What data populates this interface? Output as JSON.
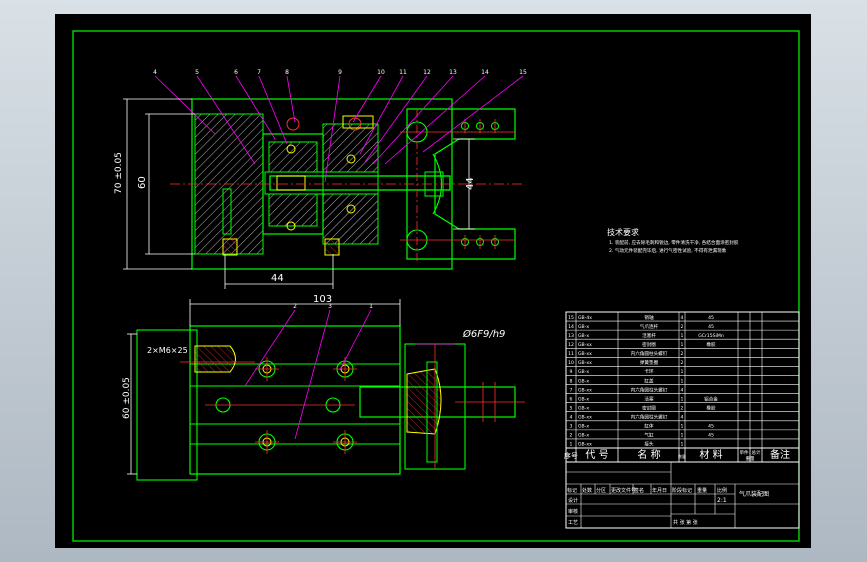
{
  "drawing": {
    "tech_req_title": "技术要求",
    "tech_req_lines": [
      "1. 装配前, 应去除毛刺和锐边, 零件清洗干净, 各结合面涂密封胶",
      "2. 气动元件装配完毕后, 进行气密性试验, 不得有泄漏现象"
    ],
    "top_view": {
      "balloons": [
        "4",
        "5",
        "6",
        "7",
        "8",
        "9",
        "10",
        "11",
        "12",
        "13",
        "14",
        "15"
      ],
      "dim_height_outer": "70 ±0.05",
      "dim_height_inner": "60",
      "dim_bottom": "44",
      "dim_right": "44"
    },
    "front_view": {
      "balloons": [
        "2",
        "3",
        "1"
      ],
      "dim_width": "103",
      "fit_note": "Ø6F9/h9",
      "thread_note": "2×M6×25",
      "dim_height": "60 ±0.05"
    },
    "bom": {
      "rows": [
        {
          "no": "15",
          "code": "GB-4x",
          "name": "销轴",
          "qty": "4",
          "material": "45"
        },
        {
          "no": "14",
          "code": "GB-x",
          "name": "气爪连杆",
          "qty": "2",
          "material": "45"
        },
        {
          "no": "13",
          "code": "GB-x",
          "name": "活塞杆",
          "qty": "1",
          "material": "GCr15SiMn"
        },
        {
          "no": "12",
          "code": "GB-xx",
          "name": "密封圈",
          "qty": "1",
          "material": "橡胶"
        },
        {
          "no": "11",
          "code": "GB-xx",
          "name": "内六角圆柱头螺钉",
          "qty": "2",
          "material": ""
        },
        {
          "no": "10",
          "code": "GB-xx",
          "name": "弹簧垫圈",
          "qty": "2",
          "material": ""
        },
        {
          "no": "9",
          "code": "GB-x",
          "name": "卡环",
          "qty": "1",
          "material": ""
        },
        {
          "no": "8",
          "code": "GB-x",
          "name": "缸盖",
          "qty": "1",
          "material": ""
        },
        {
          "no": "7",
          "code": "GB-xx",
          "name": "内六角圆柱头螺钉",
          "qty": "4",
          "material": ""
        },
        {
          "no": "6",
          "code": "GB-x",
          "name": "活塞",
          "qty": "1",
          "material": "铝合金"
        },
        {
          "no": "5",
          "code": "GB-x",
          "name": "密封圈",
          "qty": "2",
          "material": "橡胶"
        },
        {
          "no": "4",
          "code": "GB-xx",
          "name": "内六角圆柱头螺钉",
          "qty": "4",
          "material": ""
        },
        {
          "no": "3",
          "code": "GB-x",
          "name": "缸体",
          "qty": "1",
          "material": "45"
        },
        {
          "no": "2",
          "code": "GB-x",
          "name": "气缸",
          "qty": "1",
          "material": "45"
        },
        {
          "no": "1",
          "code": "GB-xx",
          "name": "接头",
          "qty": "1",
          "material": ""
        }
      ],
      "header": {
        "no": "序号",
        "code": "代 号",
        "name": "名 称",
        "qty": "数量",
        "material": "材 料",
        "unit_weight": "单件",
        "total_weight": "总计",
        "weight": "重量",
        "remark": "备注"
      }
    },
    "title_block": {
      "drawing_name": "气爪装配图",
      "row_labels": [
        "标记",
        "处数",
        "分区",
        "更改文件号",
        "签名",
        "年月日"
      ],
      "design": "设计",
      "review": "审核",
      "process": "工艺",
      "stage_mark": "阶段标记",
      "weight_label": "重量",
      "scale_label": "比例",
      "scale_value": "2:1",
      "sheets": "共  张  第  张"
    }
  },
  "colors": {
    "background": "#000000",
    "frame": "#00ff00",
    "object_line": "#00ff00",
    "hidden_line": "#ff0000",
    "dimension": "#ffffff",
    "leader": "#ff00ff",
    "fastener": "#ffff00",
    "hatch": "#ffffff"
  }
}
